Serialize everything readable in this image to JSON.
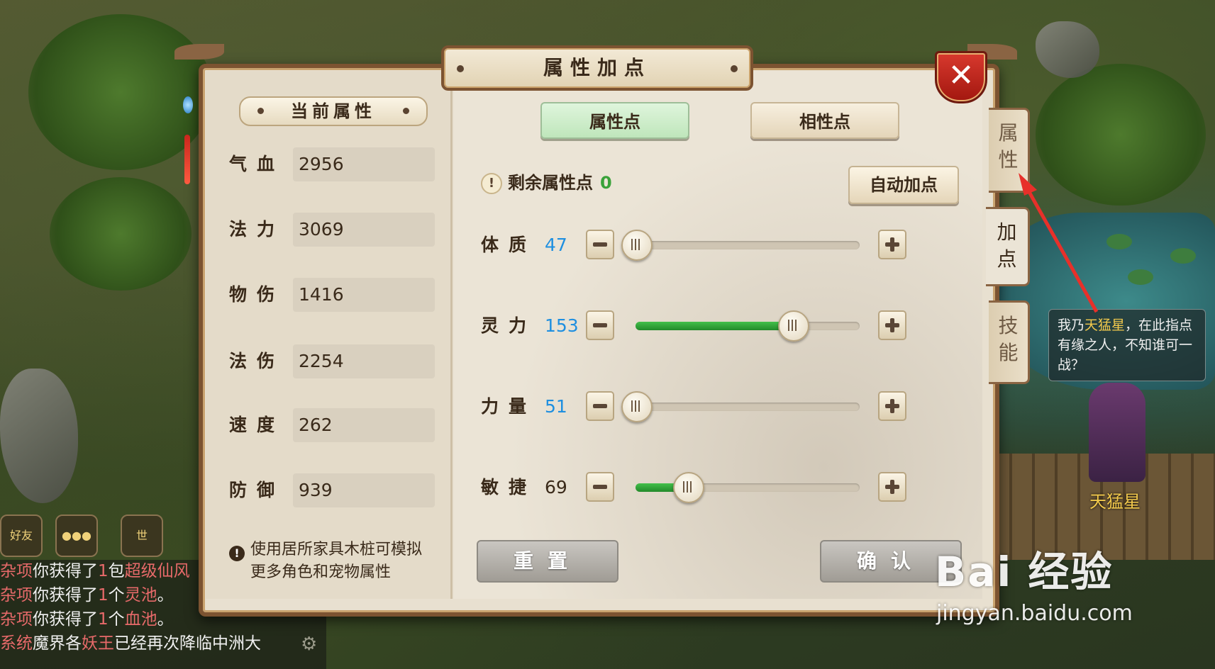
{
  "panel": {
    "title": "属性加点",
    "close_symbol": "✕"
  },
  "current_attributes": {
    "title": "当前属性",
    "stats": [
      {
        "label": "气血",
        "value": "2956"
      },
      {
        "label": "法力",
        "value": "3069"
      },
      {
        "label": "物伤",
        "value": "1416"
      },
      {
        "label": "法伤",
        "value": "2254"
      },
      {
        "label": "速度",
        "value": "262"
      },
      {
        "label": "防御",
        "value": "939"
      }
    ],
    "tip": "使用居所家具木桩可模拟更多角色和宠物属性"
  },
  "tabs": {
    "attribute_points": "属性点",
    "affinity_points": "相性点"
  },
  "remaining": {
    "label": "剩余属性点",
    "value": "0"
  },
  "auto_button": "自动加点",
  "attributes": [
    {
      "name": "体质",
      "value": "47",
      "fraction": 0.0
    },
    {
      "name": "灵力",
      "value": "153",
      "fraction": 0.7
    },
    {
      "name": "力量",
      "value": "51",
      "fraction": 0.0
    },
    {
      "name": "敏捷",
      "value": "69",
      "fraction": 0.23
    }
  ],
  "buttons": {
    "reset": "重置",
    "confirm": "确认"
  },
  "side_tabs": [
    "属性",
    "加点",
    "技能"
  ],
  "npc": {
    "dialog_prefix": "我乃",
    "dialog_name": "天猛星",
    "dialog_rest": "，在此指点有缘之人，不知谁可一战？",
    "name": "天猛星"
  },
  "chat": {
    "friends_label": "好友",
    "world_label": "世",
    "lines": [
      {
        "tag": "杂项",
        "text": "你获得了",
        "num": "1",
        "mid": "包",
        "item": "超级仙风"
      },
      {
        "tag": "杂项",
        "text": "你获得了",
        "num": "1",
        "mid": "个",
        "item": "灵池",
        "end": "。"
      },
      {
        "tag": "杂项",
        "text": "你获得了",
        "num": "1",
        "mid": "个",
        "item": "血池",
        "end": "。"
      },
      {
        "tag": "系统",
        "text": "魔界各",
        "item": "妖王",
        "end": "已经再次降临中洲大"
      }
    ]
  },
  "watermark": {
    "logo": "Bai 经验",
    "url": "jingyan.baidu.com"
  },
  "colors": {
    "frame": "#7c5331",
    "accent_green": "#3aa23a",
    "value_blue": "#1e8fe0",
    "close_red": "#c0291f"
  }
}
